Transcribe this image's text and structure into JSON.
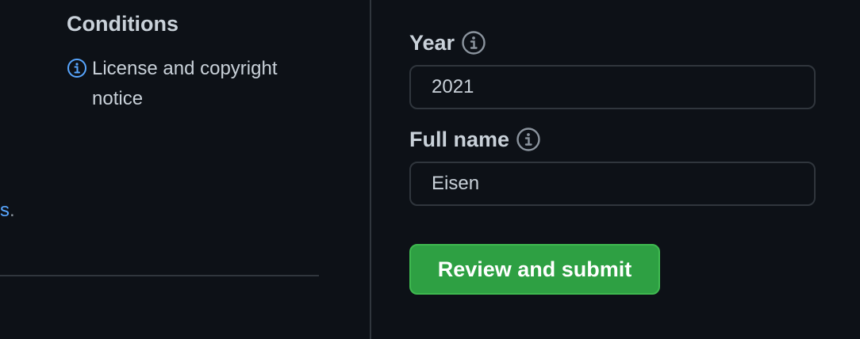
{
  "conditions": {
    "heading": "Conditions",
    "items": [
      {
        "icon": "info-icon",
        "label": "License and copyright notice"
      }
    ]
  },
  "left_link": {
    "fragment": "s",
    "trailing": "."
  },
  "form": {
    "year": {
      "label": "Year",
      "value": "2021",
      "help_icon": "info-icon"
    },
    "full_name": {
      "label": "Full name",
      "value": "Eisen",
      "help_icon": "info-icon"
    },
    "submit_label": "Review and submit"
  },
  "colors": {
    "background": "#0d1117",
    "text": "#c9d1d9",
    "link": "#58a6ff",
    "border": "#30363d",
    "submit_bg": "#2ea043"
  }
}
